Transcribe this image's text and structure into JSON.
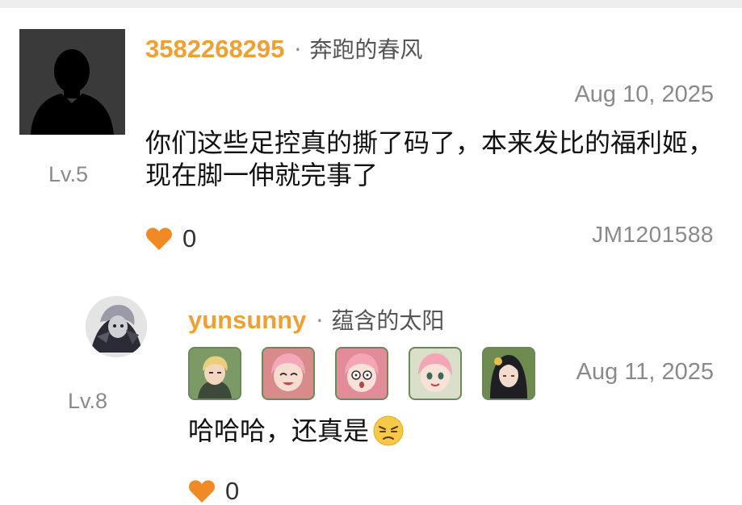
{
  "main_comment": {
    "username": "3582268295",
    "separator": "·",
    "nickname": "奔跑的春风",
    "level": "Lv.5",
    "date": "Aug 10, 2025",
    "text": "你们这些足控真的撕了码了，本来发比的福利姬，现在脚一伸就完事了",
    "like_count": "0",
    "post_id": "JM1201588",
    "avatar": "default-silhouette-icon"
  },
  "reply": {
    "username": "yunsunny",
    "separator": "·",
    "nickname": "蕴含的太阳",
    "level": "Lv.8",
    "date": "Aug 11, 2025",
    "text": "哈哈哈，还真是",
    "emoji": "annoyed-face-emoji",
    "like_count": "0",
    "badges": [
      "blonde-man-badge",
      "pink-hair-girl-laughing-badge",
      "pink-hair-girl-shocked-badge",
      "pink-hair-girl-smiling-badge",
      "black-hair-woman-badge"
    ]
  },
  "colors": {
    "username": "#f0a030",
    "heart": "#f08a24",
    "meta_gray": "#8a8a8a"
  }
}
